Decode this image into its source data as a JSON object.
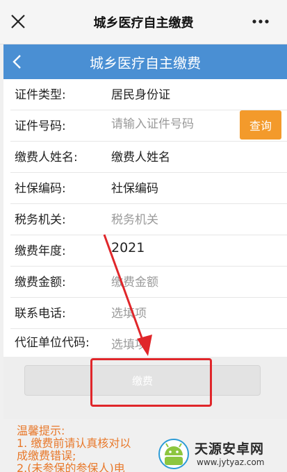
{
  "window": {
    "title": "城乡医疗自主缴费",
    "close_icon": "close-icon",
    "more_icon": "more-icon"
  },
  "navbar": {
    "title": "城乡医疗自主缴费",
    "back_icon": "chevron-left-icon",
    "color": "#4a8fd3"
  },
  "form": {
    "id_type": {
      "label": "证件类型:",
      "value": "居民身份证"
    },
    "id_number": {
      "label": "证件号码:",
      "placeholder": "请输入证件号码"
    },
    "query_button": "查询",
    "payer_name": {
      "label": "缴费人姓名:",
      "value": "缴费人姓名"
    },
    "social_code": {
      "label": "社保编码:",
      "value": "社保编码"
    },
    "tax_office": {
      "label": "税务机关:",
      "value": "税务机关"
    },
    "pay_year": {
      "label": "缴费年度:",
      "value": "2021"
    },
    "pay_amount": {
      "label": "缴费金额:",
      "value": "缴费金额"
    },
    "phone": {
      "label": "联系电话:",
      "value": "选填项"
    },
    "agent_code": {
      "label": "代征单位代码:",
      "value": "选填项"
    }
  },
  "pay_button": "缴费",
  "tips": {
    "title": "温馨提示:",
    "line1": "1. 缴费前请认真核对以",
    "line2": "成缴费错误;",
    "line3": "2.(未参保的参保人)电"
  },
  "watermark": {
    "name": "天源安卓网",
    "url": "www.jytyaz.com"
  },
  "colors": {
    "accent": "#4a8fd3",
    "query": "#f39a2b",
    "tips": "#e8782a",
    "annotation": "#e0262a"
  }
}
